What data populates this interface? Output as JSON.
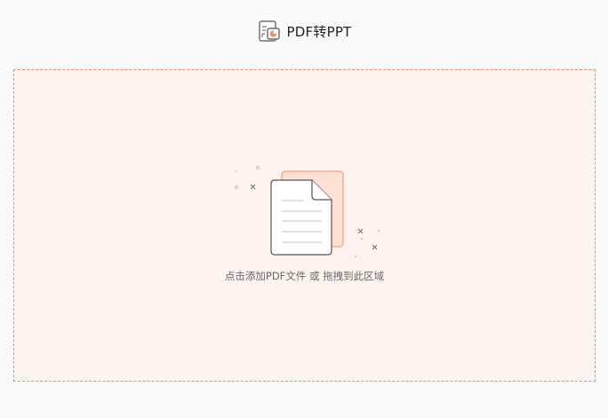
{
  "header": {
    "icon": "pdf-to-ppt-icon",
    "title": "PDF转PPT"
  },
  "drop_zone": {
    "hint": "点击添加PDF文件 或 拖拽到此区域",
    "icon": "document-upload-icon"
  },
  "colors": {
    "accent": "#ef8f69",
    "zone_background": "#fff3ef",
    "page_background": "#fafafa"
  }
}
